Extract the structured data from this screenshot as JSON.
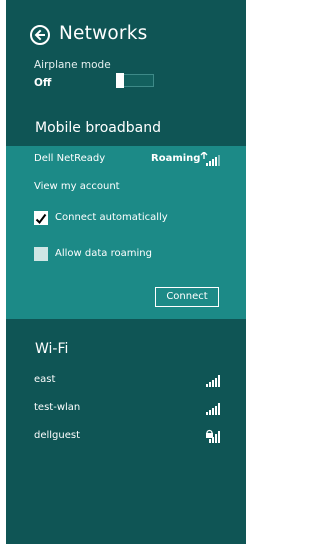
{
  "header": {
    "title": "Networks",
    "airplane_label": "Airplane mode",
    "airplane_state": "Off"
  },
  "mobile_broadband": {
    "heading": "Mobile broadband",
    "name": "Dell NetReady",
    "status": "Roaming",
    "view_account": "View my account",
    "connect_auto_label": "Connect automatically",
    "connect_auto_checked": true,
    "allow_roaming_label": "Allow data roaming",
    "allow_roaming_checked": false,
    "connect_label": "Connect"
  },
  "wifi": {
    "heading": "Wi-Fi",
    "networks": [
      {
        "name": "east",
        "secured": false
      },
      {
        "name": "test-wlan",
        "secured": false
      },
      {
        "name": "dellguest",
        "secured": true
      }
    ]
  },
  "colors": {
    "pane_bg": "#0f5555",
    "selected_bg": "#1c8a87",
    "text": "#ffffff"
  }
}
